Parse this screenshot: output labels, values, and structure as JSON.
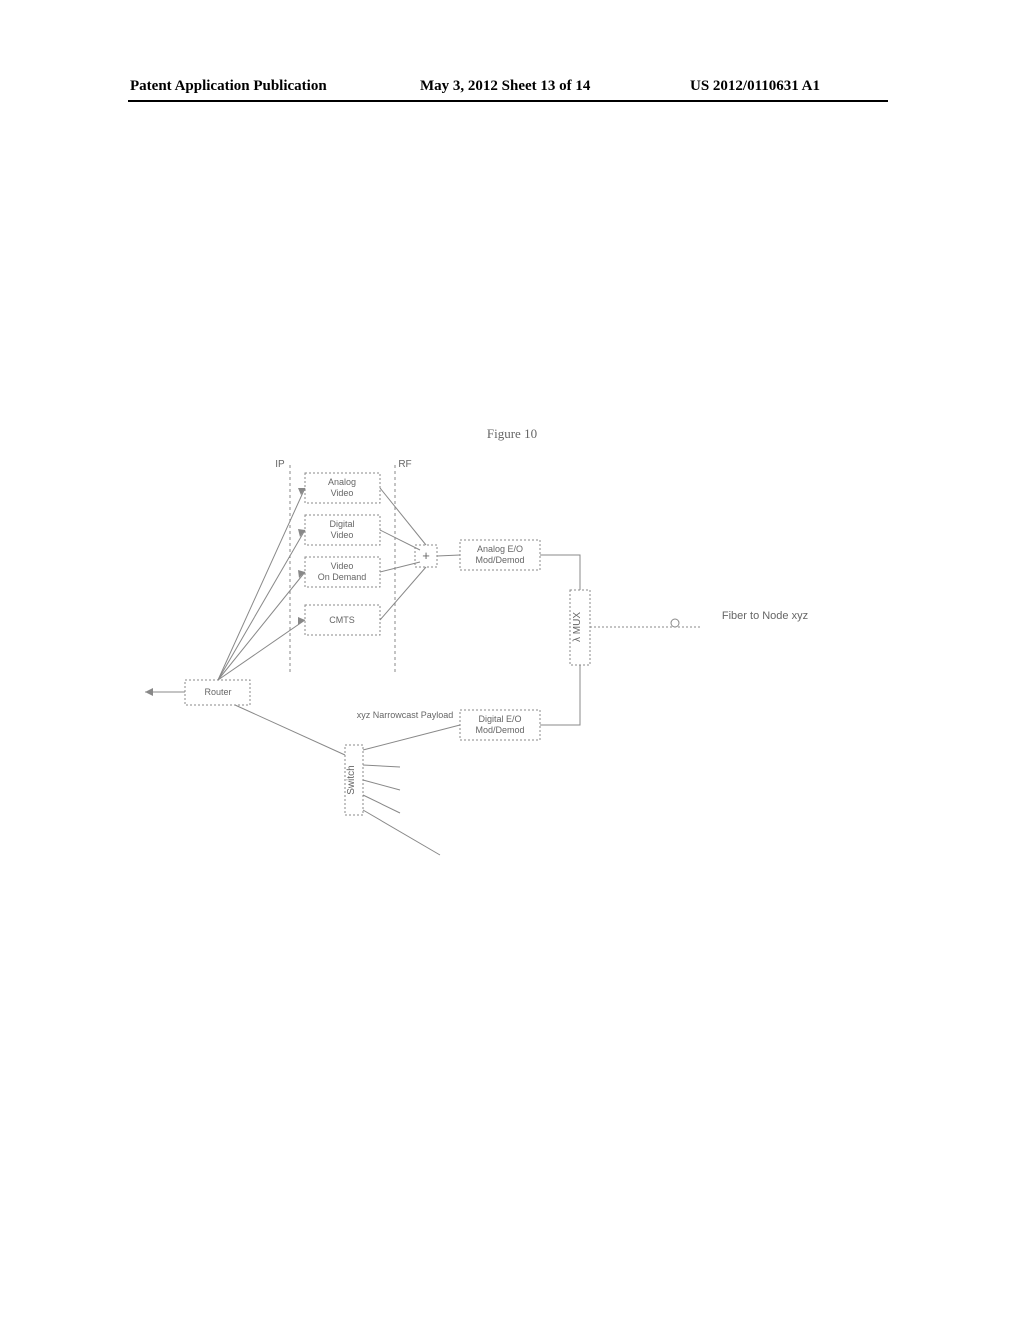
{
  "header": {
    "left": "Patent Application Publication",
    "mid": "May 3, 2012   Sheet 13 of 14",
    "right": "US 2012/0110631 A1"
  },
  "figure_title": "Figure 10",
  "labels": {
    "ip": "IP",
    "rf": "RF",
    "analog_video_l1": "Analog",
    "analog_video_l2": "Video",
    "digital_video_l1": "Digital",
    "digital_video_l2": "Video",
    "vod_l1": "Video",
    "vod_l2": "On Demand",
    "cmts": "CMTS",
    "router": "Router",
    "combiner": "+",
    "analog_eo_l1": "Analog E/O",
    "analog_eo_l2": "Mod/Demod",
    "digital_eo_l1": "Digital E/O",
    "digital_eo_l2": "Mod/Demod",
    "lambda_mux": "λ MUX",
    "switch": "Switch",
    "narrowcast": "xyz Narrowcast Payload",
    "fiber_label": "Fiber to Node xyz"
  }
}
